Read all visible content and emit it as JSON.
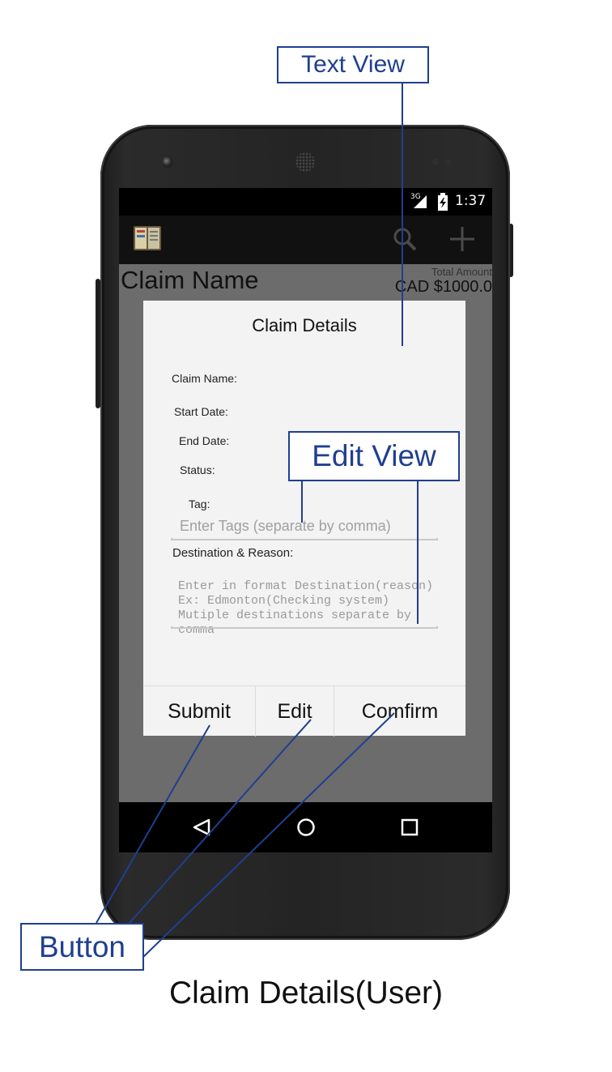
{
  "status_bar": {
    "network": "3G",
    "time": "1:37"
  },
  "background_screen": {
    "claim_name": "Claim Name",
    "total_label": "Total Amount",
    "total_value": "CAD $1000.0"
  },
  "dialog": {
    "title": "Claim Details",
    "fields": {
      "claim_name": "Claim Name:",
      "start_date": "Start Date:",
      "end_date": "End Date:",
      "status": "Status:",
      "tag": "Tag:",
      "destination": "Destination  & Reason:"
    },
    "tags_placeholder": "Enter Tags (separate by comma)",
    "destination_placeholder_lines": [
      "Enter in format  Destination(reason)",
      "Ex: Edmonton(Checking system)",
      "Mutiple destinations separate by comma"
    ],
    "buttons": {
      "submit": "Submit",
      "edit": "Edit",
      "confirm": "Comfirm"
    }
  },
  "callouts": {
    "text_view": "Text View",
    "edit_view": "Edit View",
    "button": "Button"
  },
  "caption": "Claim Details(User)",
  "colors": {
    "callout": "#1f3f8f",
    "dialog_bg": "#f3f3f3",
    "screen_dim": "#6c6c6c"
  },
  "icons": [
    "app-icon",
    "search-icon",
    "add-icon",
    "back-icon",
    "home-icon",
    "recent-apps-icon",
    "signal-icon",
    "battery-icon"
  ]
}
